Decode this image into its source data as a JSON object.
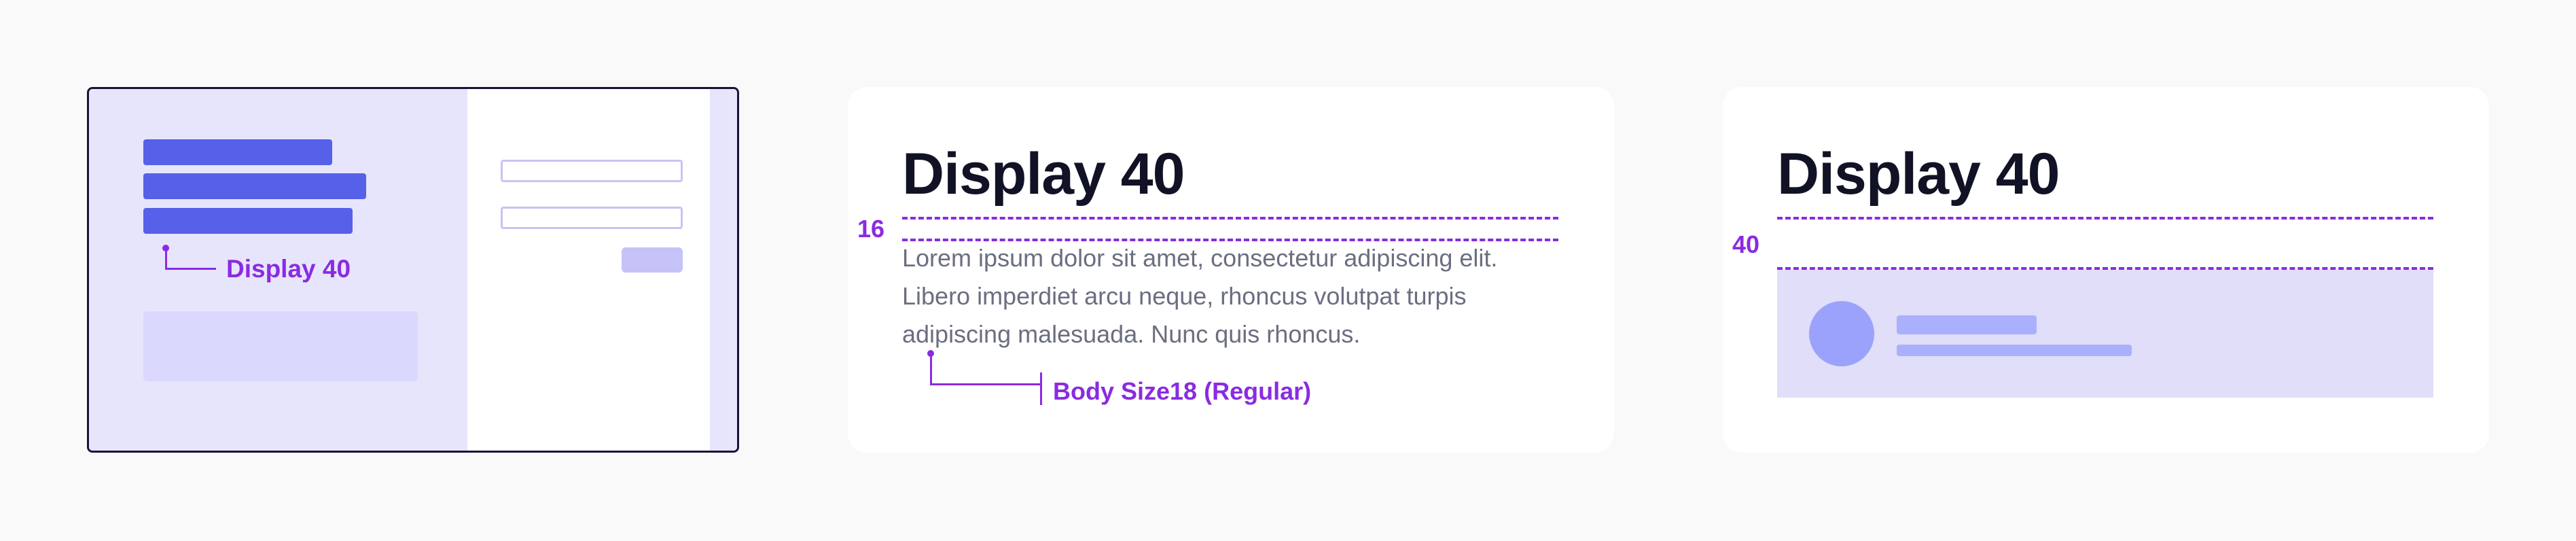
{
  "colors": {
    "background": "#f9f9f9",
    "accent": "#8a2be2",
    "primary_bar": "#5660e8",
    "light_fill": "#e7e5fc",
    "heading_text": "#121226",
    "body_text": "#6b6e80"
  },
  "wireframe": {
    "annotation_label": "Display 40"
  },
  "typography_card": {
    "heading": "Display 40",
    "spacing_label": "16",
    "body_lines": [
      "Lorem ipsum dolor sit amet, consectetur adipiscing elit.",
      "Libero imperdiet arcu neque, rhoncus volutpat turpis",
      "adipiscing malesuada. Nunc quis rhoncus."
    ],
    "annotation_label": "Body Size18 (Regular)"
  },
  "content_card": {
    "heading": "Display 40",
    "spacing_label": "40"
  }
}
